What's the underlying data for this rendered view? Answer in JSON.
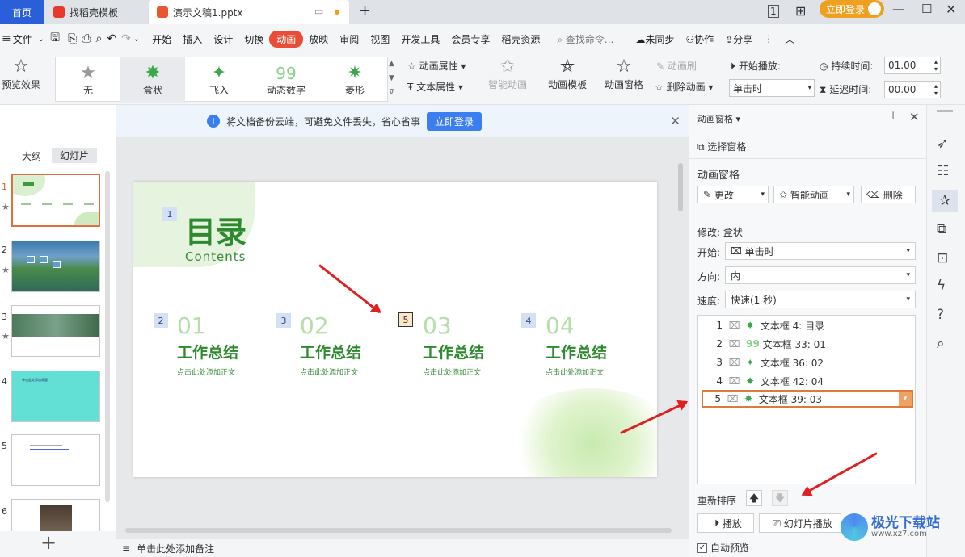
{
  "titlebar": {
    "tab_home": "首页",
    "tab_templates": "找稻壳模板",
    "tab_document": "演示文稿1.pptx",
    "login_button": "立即登录",
    "new_tab": "+"
  },
  "menu": {
    "file": "文件",
    "items": [
      "开始",
      "插入",
      "设计",
      "切换",
      "动画",
      "放映",
      "审阅",
      "视图",
      "开发工具",
      "会员专享",
      "稻壳资源"
    ],
    "search": "查找命令...",
    "sync": "未同步",
    "collab": "协作",
    "share": "分享"
  },
  "ribbon": {
    "preview": "预览效果",
    "gallery": [
      "无",
      "盒状",
      "飞入",
      "动态数字",
      "菱形"
    ],
    "anim_props": "动画属性",
    "text_props": "文本属性",
    "smart_anim": "智能动画",
    "anim_template": "动画模板",
    "anim_pane": "动画窗格",
    "anim_brush": "动画刷",
    "delete_anim": "删除动画",
    "start_play": "开始播放:",
    "start_value": "单击时",
    "duration_label": "持续时间:",
    "duration_value": "01.00",
    "delay_label": "延迟时间:",
    "delay_value": "00.00"
  },
  "notice": {
    "text": "将文档备份云端，可避免文件丢失，省心省事",
    "button": "立即登录"
  },
  "leftpanel": {
    "tab_outline": "大纲",
    "tab_slides": "幻灯片",
    "slides": [
      "1",
      "2",
      "3",
      "4",
      "5",
      "6"
    ],
    "slide4_text": "单击此处添加标题",
    "add": "+"
  },
  "slide": {
    "title": "目录",
    "subtitle": "Contents",
    "badge_title": "1",
    "items": [
      {
        "badge": "2",
        "num": "01",
        "title": "工作总结",
        "sub": "点击此处添加正文"
      },
      {
        "badge": "3",
        "num": "02",
        "title": "工作总结",
        "sub": "点击此处添加正文"
      },
      {
        "badge": "5",
        "num": "03",
        "title": "工作总结",
        "sub": "点击此处添加正文"
      },
      {
        "badge": "4",
        "num": "04",
        "title": "工作总结",
        "sub": "点击此处添加正文"
      }
    ]
  },
  "notes": "单击此处添加备注",
  "pane": {
    "header": "动画窗格",
    "select_pane": "选择窗格",
    "section_title": "动画窗格",
    "change": "更改",
    "smart": "智能动画",
    "delete": "删除",
    "modify": "修改: 盒状",
    "start_label": "开始:",
    "start_value": "单击时",
    "direction_label": "方向:",
    "direction_value": "内",
    "speed_label": "速度:",
    "speed_value": "快速(1 秒)",
    "list": [
      {
        "n": "1",
        "label": "文本框 4: 目录"
      },
      {
        "n": "2",
        "label": "文本框 33: 01"
      },
      {
        "n": "3",
        "label": "文本框 36: 02"
      },
      {
        "n": "4",
        "label": "文本框 42: 04"
      },
      {
        "n": "5",
        "label": "文本框 39: 03"
      }
    ],
    "reorder": "重新排序",
    "play": "播放",
    "slideshow": "幻灯片播放",
    "auto_preview": "自动预览"
  },
  "watermark": {
    "site": "极光下载站",
    "url": "www.xz7.com"
  },
  "colors": {
    "accent": "#e94d35",
    "green": "#2e8a2e",
    "blue": "#2b5fd9",
    "arrow": "#e02020"
  }
}
